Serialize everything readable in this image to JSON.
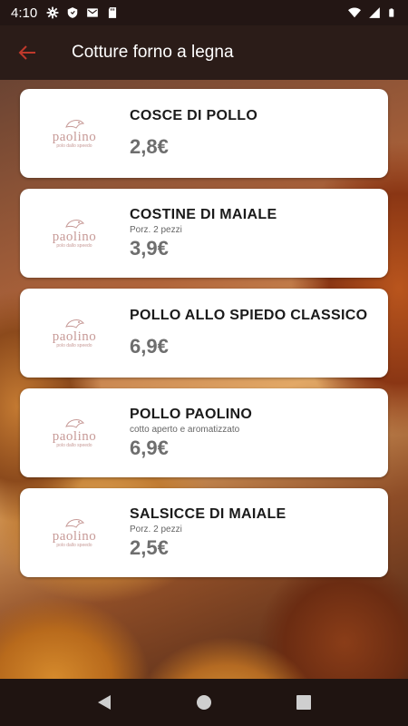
{
  "status_bar": {
    "time": "4:10",
    "left_icons": [
      "gear-icon",
      "shield-icon",
      "mail-icon",
      "sd-card-icon"
    ],
    "right_icons": [
      "wifi-icon",
      "signal-icon",
      "battery-icon"
    ]
  },
  "app_bar": {
    "back_icon": "arrow-left-icon",
    "title": "Cotture forno a legna",
    "accent_color": "#c0392b"
  },
  "logo": {
    "word": "paolino",
    "tagline": "polo dallo speedo"
  },
  "items": [
    {
      "name": "COSCE DI POLLO",
      "note": "",
      "price": "2,8€"
    },
    {
      "name": "COSTINE DI MAIALE",
      "note": "Porz. 2 pezzi",
      "price": "3,9€"
    },
    {
      "name": "POLLO ALLO SPIEDO CLASSICO",
      "note": "",
      "price": "6,9€"
    },
    {
      "name": "POLLO PAOLINO",
      "note": "cotto aperto e aromatizzato",
      "price": "6,9€"
    },
    {
      "name": "SALSICCE DI MAIALE",
      "note": "Porz. 2 pezzi",
      "price": "2,5€"
    }
  ],
  "nav_bar": {
    "buttons": [
      "back-triangle-icon",
      "home-circle-icon",
      "recents-square-icon"
    ]
  }
}
